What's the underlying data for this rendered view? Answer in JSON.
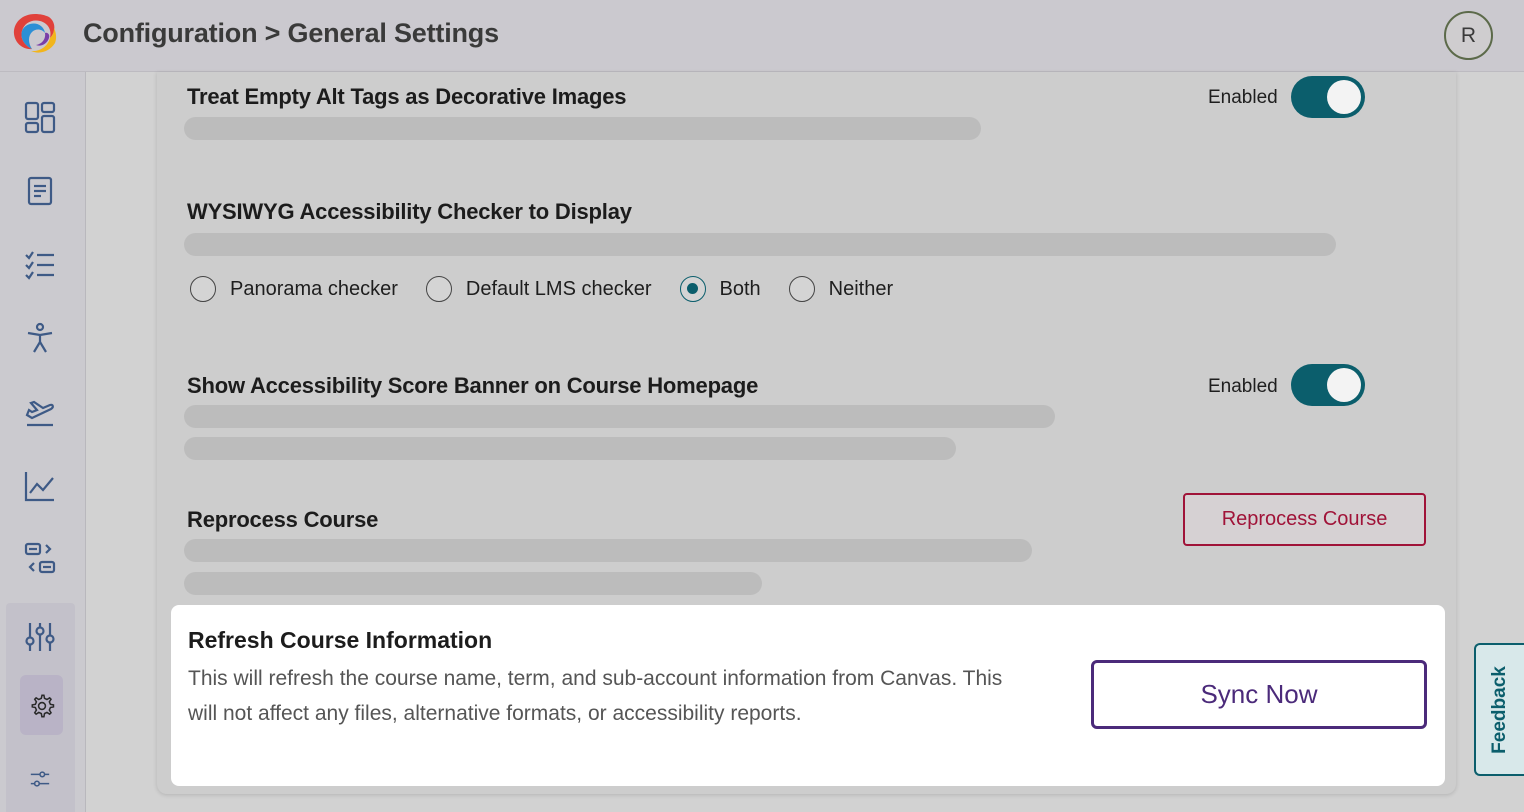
{
  "header": {
    "title": "Configuration > General Settings",
    "avatar_initial": "R"
  },
  "sidebar": {
    "items": [
      {
        "icon": "dashboard-icon"
      },
      {
        "icon": "document-icon"
      },
      {
        "icon": "checklist-icon"
      },
      {
        "icon": "accessibility-icon"
      },
      {
        "icon": "plane-takeoff-icon"
      },
      {
        "icon": "line-chart-icon"
      },
      {
        "icon": "transfer-icon"
      },
      {
        "icon": "sliders-vertical-icon"
      },
      {
        "icon": "gear-icon"
      },
      {
        "icon": "sliders-horizontal-icon"
      }
    ]
  },
  "settings": {
    "empty_alt": {
      "title": "Treat Empty Alt Tags as Decorative Images",
      "toggle_label": "Enabled",
      "enabled": true
    },
    "wysiwyg": {
      "title": "WYSIWYG Accessibility Checker to Display",
      "options": [
        "Panorama checker",
        "Default LMS checker",
        "Both",
        "Neither"
      ],
      "selected": "Both"
    },
    "score_banner": {
      "title": "Show Accessibility Score Banner on Course Homepage",
      "toggle_label": "Enabled",
      "enabled": true
    },
    "reprocess": {
      "title": "Reprocess Course",
      "button_label": "Reprocess Course"
    },
    "refresh": {
      "title": "Refresh Course Information",
      "description": "This will refresh the course name, term, and sub-account information from Canvas. This will not affect any files, alternative formats, or accessibility reports.",
      "button_label": "Sync Now"
    }
  },
  "feedback": {
    "label": "Feedback"
  },
  "colors": {
    "teal": "#0b5e6c",
    "crimson": "#a01338",
    "purple": "#4b2a7a"
  }
}
